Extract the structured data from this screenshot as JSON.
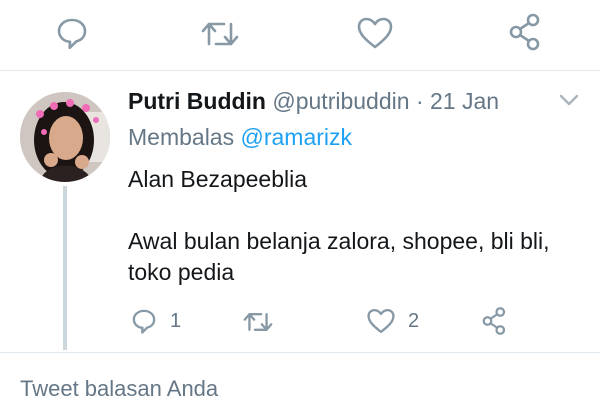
{
  "top_actions": {
    "reply": "reply-icon",
    "retweet": "retweet-icon",
    "like": "heart-icon",
    "share": "share-icon"
  },
  "tweet": {
    "name": "Putri Buddin",
    "handle": "@putribuddin",
    "separator": "·",
    "date": "21 Jan",
    "reply_prefix": "Membalas",
    "reply_to": "@ramarizk",
    "text_line1": "Alan Bezapeeblia",
    "text_line2": "Awal bulan belanja zalora, shopee, bli bli, toko pedia",
    "reply_count": "1",
    "like_count": "2"
  },
  "composer": {
    "placeholder": "Tweet balasan Anda"
  },
  "colors": {
    "accent": "#1da1f2",
    "muted": "#657786",
    "icon": "#8899a6",
    "divider": "#e1e8ed"
  }
}
